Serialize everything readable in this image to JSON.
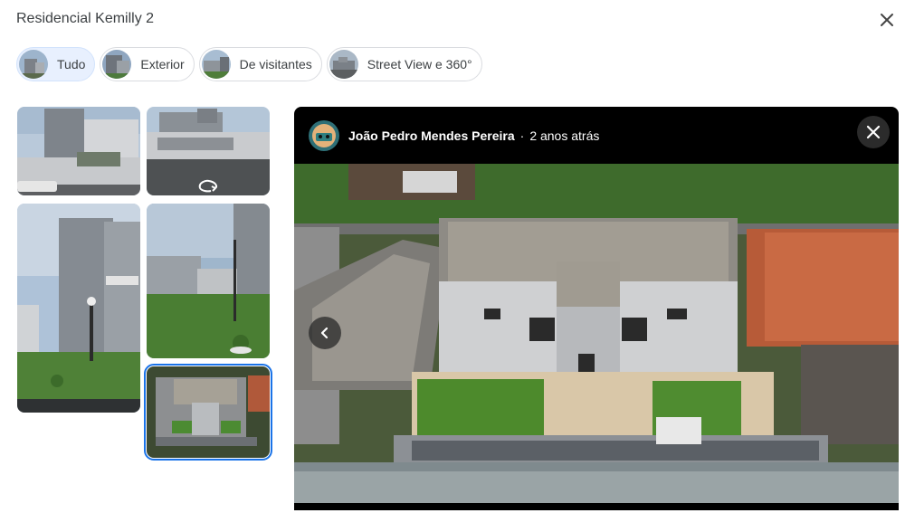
{
  "place": {
    "title": "Residencial Kemilly 2"
  },
  "filters": [
    {
      "label": "Tudo",
      "active": true
    },
    {
      "label": "Exterior",
      "active": false
    },
    {
      "label": "De visitantes",
      "active": false
    },
    {
      "label": "Street View e 360°",
      "active": false
    }
  ],
  "viewer": {
    "author": "João Pedro Mendes Pereira",
    "separator": "·",
    "time": "2 anos atrás"
  },
  "icons": {
    "close": "close-icon",
    "prev": "chevron-left-icon",
    "street_view": "street-view-360-icon"
  },
  "colors": {
    "accent": "#1a73e8",
    "chip_active_bg": "#e8f0fe"
  }
}
